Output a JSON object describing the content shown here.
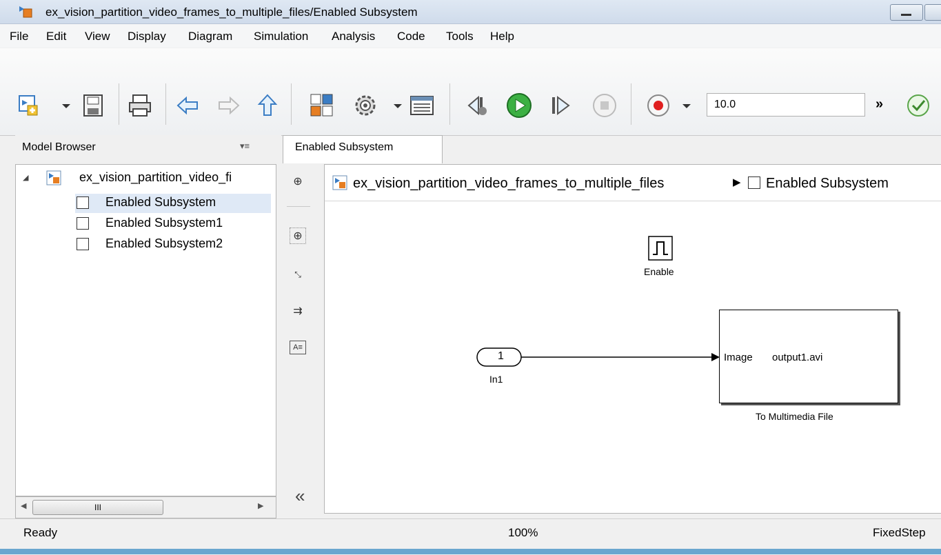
{
  "window": {
    "title": "ex_vision_partition_video_frames_to_multiple_files/Enabled Subsystem"
  },
  "menu": [
    "File",
    "Edit",
    "View",
    "Display",
    "Diagram",
    "Simulation",
    "Analysis",
    "Code",
    "Tools",
    "Help"
  ],
  "toolbar": {
    "stop_time": "10.0",
    "overflow_label": "»"
  },
  "model_browser": {
    "title": "Model Browser",
    "root": "ex_vision_partition_video_fi",
    "children": [
      "Enabled Subsystem",
      "Enabled Subsystem1",
      "Enabled Subsystem2"
    ],
    "scroll_thumb": "III"
  },
  "tab": {
    "label": "Enabled Subsystem"
  },
  "breadcrumb": {
    "model": "ex_vision_partition_video_frames_to_multiple_files",
    "subsystem": "Enabled Subsystem"
  },
  "diagram": {
    "enable_label": "Enable",
    "in_port_number": "1",
    "in_label": "In1",
    "mm_port_label": "Image",
    "mm_file": "output1.avi",
    "mm_label": "To Multimedia File"
  },
  "palette": {
    "collapse": "«"
  },
  "status": {
    "left": "Ready",
    "zoom": "100%",
    "solver": "FixedStep"
  }
}
